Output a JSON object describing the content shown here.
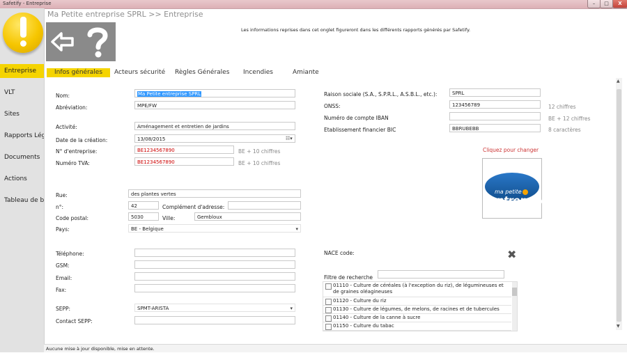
{
  "window": {
    "title": "Safetify - Entreprise",
    "min_label": "–",
    "max_label": "□",
    "close_label": "X"
  },
  "sidebar": {
    "items": [
      {
        "label": "Entreprise",
        "active": true
      },
      {
        "label": "VLT",
        "active": false
      },
      {
        "label": "Sites",
        "active": false
      },
      {
        "label": "Rapports Léga",
        "active": false
      },
      {
        "label": "Documents",
        "active": false
      },
      {
        "label": "Actions",
        "active": false
      },
      {
        "label": "Tableau de bo",
        "active": false
      }
    ]
  },
  "header": {
    "breadcrumb": "Ma Petite entreprise SPRL >> Entreprise",
    "info": "Les informations reprises dans cet onglet figureront dans les différents rapports générés par Safetify.",
    "back_icon": "back-arrow-icon",
    "help_icon": "question-mark-icon"
  },
  "tabs": [
    {
      "label": "Infos générales",
      "active": true
    },
    {
      "label": "Acteurs sécurité",
      "active": false
    },
    {
      "label": "Règles Générales",
      "active": false
    },
    {
      "label": "Incendies",
      "active": false
    },
    {
      "label": "Amiante",
      "active": false
    }
  ],
  "form": {
    "nom": {
      "label": "Nom:",
      "value": "Ma Petite entreprise SPRL"
    },
    "abreviation": {
      "label": "Abréviation:",
      "value": "MPE/FW"
    },
    "activite": {
      "label": "Activité:",
      "value": "Aménagement et entretien de jardins"
    },
    "date_creation": {
      "label": "Date de la création:",
      "value": "13/08/2015"
    },
    "num_entreprise": {
      "label": "N° d'entreprise:",
      "value": "BE1234567890",
      "hint": "BE + 10 chiffres"
    },
    "num_tva": {
      "label": "Numéro TVA:",
      "value": "BE1234567890",
      "hint": "BE + 10 chiffres"
    },
    "rue": {
      "label": "Rue:",
      "value": "des plantes vertes"
    },
    "numero": {
      "label": "n°:",
      "value": "42"
    },
    "complement": {
      "label": "Complément d'adresse:",
      "value": ""
    },
    "code_postal": {
      "label": "Code postal:",
      "value": "5030"
    },
    "ville": {
      "label": "Ville:",
      "value": "Gembloux"
    },
    "pays": {
      "label": "Pays:",
      "value": "BE - Belgique"
    },
    "telephone": {
      "label": "Téléphone:",
      "value": ""
    },
    "gsm": {
      "label": "GSM:",
      "value": ""
    },
    "email": {
      "label": "Email:",
      "value": ""
    },
    "fax": {
      "label": "Fax:",
      "value": ""
    },
    "sepp": {
      "label": "SEPP:",
      "value": "SPMT-ARISTA"
    },
    "contact_sepp": {
      "label": "Contact SEPP:",
      "value": ""
    },
    "raison_sociale": {
      "label": "Raison sociale (S.A., S.P.R.L., A.S.B.L., etc.):",
      "value": "SPRL"
    },
    "onss": {
      "label": "ONSS:",
      "value": "123456789",
      "hint": "12 chiffres"
    },
    "iban": {
      "label": "Numéro de compte IBAN",
      "value": "",
      "hint": "BE + 12 chiffres"
    },
    "bic": {
      "label": "Etablissement financier BIC",
      "value": "BBRUBEBB",
      "hint": "8 caractères"
    },
    "change_logo": "Cliquez pour changer",
    "logo_line1": "ma petite",
    "logo_line2": "entreprise",
    "nace": {
      "label": "NACE code:"
    },
    "filtre": {
      "label": "Filtre de recherche",
      "value": ""
    },
    "nace_items": [
      {
        "text": "01110 - Culture de céréales (à l'exception du riz), de légumineuses et de graines oléagineuses",
        "checked": false
      },
      {
        "text": "01120 - Culture du riz",
        "checked": false
      },
      {
        "text": "01130 - Culture de légumes, de melons, de racines et de tubercules",
        "checked": false
      },
      {
        "text": "01140 - Culture de la canne à sucre",
        "checked": false
      },
      {
        "text": "01150 - Culture du tabac",
        "checked": false
      }
    ]
  },
  "status": "Aucune mise à jour disponible, mise en attente.",
  "colors": {
    "accent": "#f5d400",
    "error": "#cc0000"
  }
}
